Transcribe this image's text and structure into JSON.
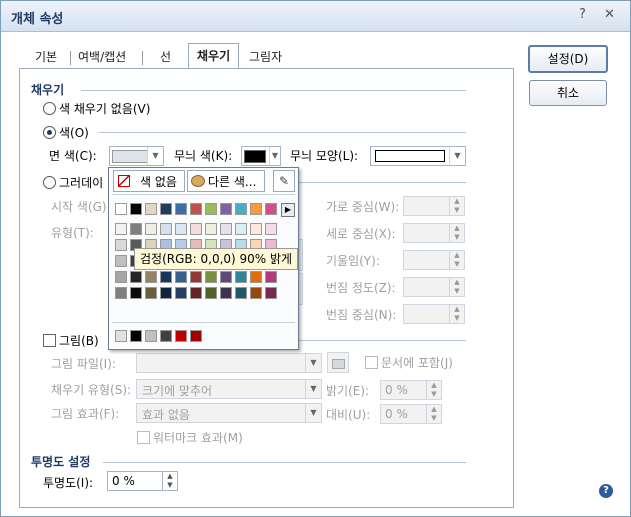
{
  "window": {
    "title": "개체 속성",
    "help_glyph": "?",
    "close_glyph": "✕"
  },
  "tabs": [
    {
      "label": "기본"
    },
    {
      "label": "여백/캡션"
    },
    {
      "label": "선"
    },
    {
      "label": "채우기"
    },
    {
      "label": "그림자"
    }
  ],
  "buttons": {
    "ok": "설정(D)",
    "cancel": "취소"
  },
  "fill": {
    "section_title": "채우기",
    "no_fill": "색 채우기 없음(V)",
    "color": "색(O)",
    "face_color": "면 색(C):",
    "pattern_color": "무늬 색(K):",
    "pattern_shape": "무늬 모양(L):",
    "gradient": "그러데이",
    "start_color": "시작 색(G)",
    "type": "유형(T):",
    "h_center": "가로 중심(W):",
    "v_center": "세로 중심(X):",
    "tilt": "기울임(Y):",
    "spread": "번짐 정도(Z):",
    "spread_center": "번짐 중심(N):"
  },
  "picture": {
    "label": "그림(B)",
    "file": "그림 파일(I):",
    "include_in_doc": "문서에 포함(J)",
    "fill_type": "채우기 유형(S):",
    "fill_type_value": "크기에 맞추어",
    "brightness": "밝기(E):",
    "brightness_value": "0 %",
    "effect": "그림 효과(F):",
    "effect_value": "효과 없음",
    "contrast": "대비(U):",
    "contrast_value": "0 %",
    "watermark": "워터마크 효과(M)"
  },
  "transparency": {
    "section_title": "투명도 설정",
    "label": "투명도(I):",
    "value": "0 %"
  },
  "palette": {
    "no_color": "색 없음",
    "other_color": "다른 색...",
    "tooltip": "검정(RGB: 0,0,0) 90% 밝게",
    "top_row": [
      "#ffffff",
      "#000000",
      "#e2d7c3",
      "#1f3b5d",
      "#3a6ea5",
      "#c04f4d",
      "#9bbb59",
      "#7f62a1",
      "#4bacc6",
      "#f59b3d",
      "#d24f8f"
    ],
    "shade_rows": [
      [
        "#f2f2f2",
        "#7f7f7f",
        "#f3eee4",
        "#d5dff0",
        "#dae6f2",
        "#f3dcdb",
        "#ebf1dd",
        "#e5e0ec",
        "#dbeef3",
        "#fde9d9",
        "#f6dbe8"
      ],
      [
        "#d9d9d9",
        "#595959",
        "#ddd3bd",
        "#aec0df",
        "#b6cde6",
        "#e7b9b7",
        "#d7e4bb",
        "#ccc1d9",
        "#b7dde8",
        "#fbd5b5",
        "#eeb8d2"
      ],
      [
        "#bfbfbf",
        "#3f3f3f",
        "#c4b58e",
        "#6c8cc0",
        "#8db3d9",
        "#da9694",
        "#c3d69b",
        "#b2a2c7",
        "#92cddc",
        "#f9bf8f",
        "#e594bb"
      ],
      [
        "#a5a5a5",
        "#262626",
        "#948660",
        "#17365d",
        "#366092",
        "#953734",
        "#76923c",
        "#5f497a",
        "#31859b",
        "#e36c09",
        "#b4397d"
      ],
      [
        "#7f7f7f",
        "#0c0c0c",
        "#6a5e3f",
        "#0f243e",
        "#244061",
        "#632423",
        "#4f6128",
        "#3f3151",
        "#205867",
        "#974806",
        "#7a2653"
      ]
    ],
    "recent": [
      "#e0e0e0",
      "#000000",
      "#c0c0c0",
      "#404040",
      "#c00000",
      "#a00000"
    ]
  }
}
